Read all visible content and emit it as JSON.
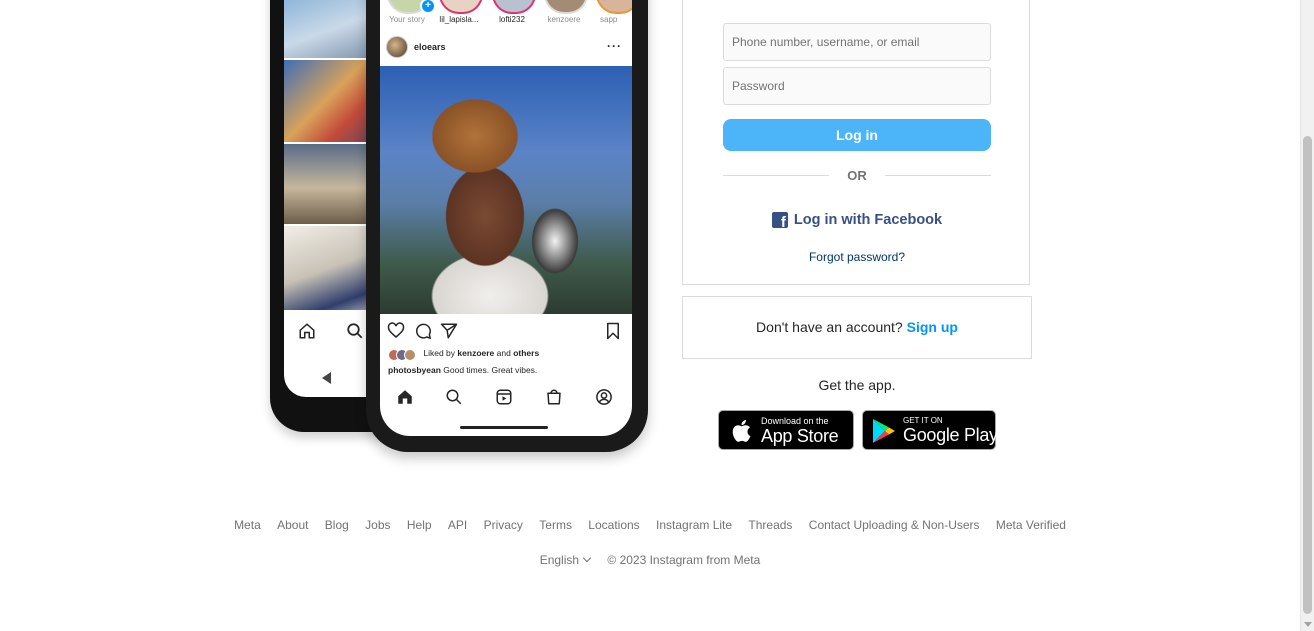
{
  "mockup": {
    "stories": [
      {
        "label": "Your story",
        "dim": true
      },
      {
        "label": "lil_lapisla..."
      },
      {
        "label": "lofti232"
      },
      {
        "label": "kenzoere",
        "dim": true
      },
      {
        "label": "sapp",
        "dim": true
      }
    ],
    "post_user": "eloears",
    "post_more": "···",
    "liked_prefix": "Liked by",
    "liked_user": "kenzoere",
    "liked_and": "and",
    "liked_others": "others",
    "caption_user": "photosbyean",
    "caption_text": "Good times. Great vibes."
  },
  "login": {
    "username_placeholder": "Phone number, username, or email",
    "password_placeholder": "Password",
    "login_button": "Log in",
    "or_text": "OR",
    "facebook_login": "Log in with Facebook",
    "forgot_password": "Forgot password?"
  },
  "signup": {
    "prompt": "Don't have an account?",
    "link": "Sign up"
  },
  "get_app": {
    "label": "Get the app.",
    "app_store_small": "Download on the",
    "app_store_big": "App Store",
    "google_play_small": "GET IT ON",
    "google_play_big": "Google Play"
  },
  "footer": {
    "links": [
      "Meta",
      "About",
      "Blog",
      "Jobs",
      "Help",
      "API",
      "Privacy",
      "Terms",
      "Locations",
      "Instagram Lite",
      "Threads",
      "Contact Uploading & Non-Users",
      "Meta Verified"
    ],
    "language": "English",
    "copyright": "© 2023 Instagram from Meta"
  },
  "colors": {
    "primary_button": "#4cb5f9",
    "link_blue": "#0095f6",
    "facebook_blue": "#385185",
    "border": "#dbdbdb",
    "muted_text": "#737373"
  }
}
